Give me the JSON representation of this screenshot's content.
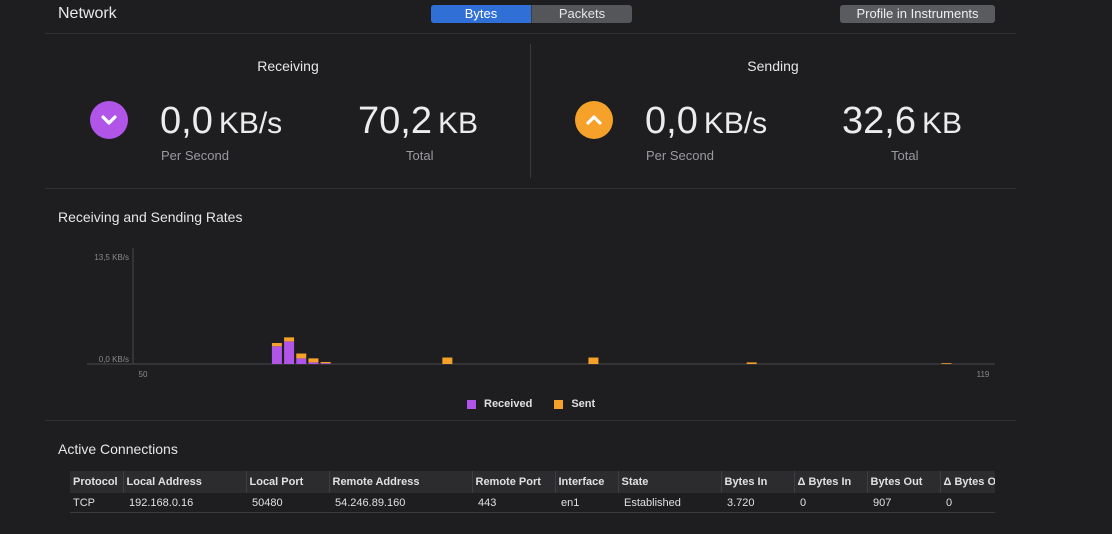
{
  "header": {
    "title": "Network",
    "segments": [
      {
        "label": "Bytes",
        "active": true
      },
      {
        "label": "Packets",
        "active": false
      }
    ],
    "profile_button": "Profile in Instruments"
  },
  "receiving": {
    "title": "Receiving",
    "rate_value": "0,0",
    "rate_unit": "KB/s",
    "rate_caption": "Per Second",
    "total_value": "70,2",
    "total_unit": "KB",
    "total_caption": "Total",
    "icon": "chevron-down-icon",
    "color": "#b055e8"
  },
  "sending": {
    "title": "Sending",
    "rate_value": "0,0",
    "rate_unit": "KB/s",
    "rate_caption": "Per Second",
    "total_value": "32,6",
    "total_unit": "KB",
    "total_caption": "Total",
    "icon": "chevron-up-icon",
    "color": "#f5a12a"
  },
  "rates": {
    "title": "Receiving and Sending Rates",
    "chart_data": {
      "type": "bar",
      "title": "Receiving and Sending Rates",
      "ylim": [
        0,
        13.5
      ],
      "y_tick_labels": [
        "13,5 KB/s",
        "0,0 KB/s"
      ],
      "x_tick_labels": [
        "50",
        "119"
      ],
      "xlim": [
        50,
        119
      ],
      "legend": "bottom",
      "series": [
        {
          "name": "Received",
          "color": "#b055e8",
          "points": [
            [
              61,
              2.2
            ],
            [
              62,
              2.8
            ],
            [
              63,
              0.7
            ],
            [
              64,
              0.2
            ],
            [
              65,
              0.1
            ],
            [
              75,
              0
            ],
            [
              87,
              0
            ],
            [
              100,
              0
            ],
            [
              116,
              0
            ]
          ]
        },
        {
          "name": "Sent",
          "color": "#f5a12a",
          "points": [
            [
              61,
              0.4
            ],
            [
              62,
              0.5
            ],
            [
              63,
              0.6
            ],
            [
              64,
              0.5
            ],
            [
              65,
              0.15
            ],
            [
              75,
              0.8
            ],
            [
              87,
              0.8
            ],
            [
              100,
              0.2
            ],
            [
              116,
              0.1
            ]
          ]
        }
      ]
    }
  },
  "connections": {
    "title": "Active Connections",
    "columns": [
      "Protocol",
      "Local Address",
      "Local Port",
      "Remote Address",
      "Remote Port",
      "Interface",
      "State",
      "Bytes In",
      "Δ Bytes In",
      "Bytes Out",
      "Δ Bytes Out"
    ],
    "rows": [
      [
        "TCP",
        "192.168.0.16",
        "50480",
        "54.246.89.160",
        "443",
        "en1",
        "Established",
        "3.720",
        "0",
        "907",
        "0"
      ]
    ]
  }
}
